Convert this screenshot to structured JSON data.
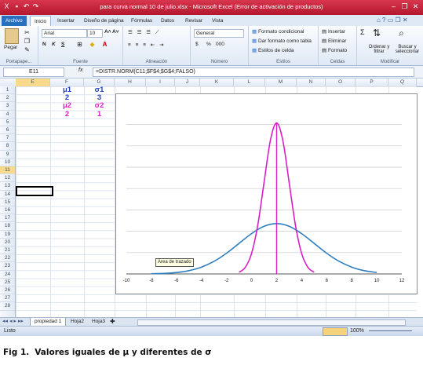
{
  "window": {
    "title": "para curva normal 10 de julio.xlsx  -  Microsoft Excel (Error de activación de productos)"
  },
  "ribbon": {
    "tabs": [
      "Archivo",
      "Inicio",
      "Insertar",
      "Diseño de página",
      "Fórmulas",
      "Datos",
      "Revisar",
      "Vista"
    ],
    "active_tab": "Inicio",
    "clipboard": {
      "paste": "Pegar",
      "label": "Portapape..."
    },
    "font": {
      "name": "Arial",
      "size": "10",
      "label": "Fuente",
      "bold": "N",
      "italic": "K",
      "underline": "S"
    },
    "alignment": {
      "label": "Alineación"
    },
    "number": {
      "format": "General",
      "label": "Número",
      "currency": "$",
      "percent": "%",
      "thousands": "000"
    },
    "styles": {
      "cond_format": "Formato condicional",
      "table_format": "Dar formato como tabla",
      "cell_styles": "Estilos de celda",
      "label": "Estilos"
    },
    "cells": {
      "insert": "Insertar",
      "delete": "Eliminar",
      "format": "Formato",
      "label": "Celdas"
    },
    "editing": {
      "sum": "Σ",
      "sort": "Ordenar y filtrar",
      "find": "Buscar y seleccionar",
      "label": "Modificar"
    }
  },
  "formula_bar": {
    "name_box": "E11",
    "fx": "fx",
    "formula": "=DISTR.NORM(C11;$F$4;$G$4;FALSO)"
  },
  "grid": {
    "columns": [
      "E",
      "F",
      "G",
      "H",
      "I",
      "J",
      "K",
      "L",
      "M",
      "N",
      "O",
      "P",
      "Q"
    ],
    "rows": [
      "1",
      "2",
      "3",
      "4",
      "5",
      "6",
      "7",
      "8",
      "9",
      "10",
      "11",
      "12",
      "13",
      "14",
      "15",
      "16",
      "17",
      "18",
      "19",
      "20",
      "21",
      "22",
      "23",
      "24",
      "25",
      "26",
      "27",
      "28"
    ],
    "selected_column": "E",
    "selected_row": "11",
    "cells": [
      {
        "ref": "F1",
        "text": "μ1",
        "color": "#1f3fbf"
      },
      {
        "ref": "G1",
        "text": "σ1",
        "color": "#1f3fbf"
      },
      {
        "ref": "F2",
        "text": "2",
        "color": "#1f3fbf"
      },
      {
        "ref": "G2",
        "text": "3",
        "color": "#1f3fbf"
      },
      {
        "ref": "F3",
        "text": "μ2",
        "color": "#e020c8"
      },
      {
        "ref": "G3",
        "text": "σ2",
        "color": "#e020c8"
      },
      {
        "ref": "F4",
        "text": "2",
        "color": "#e020c8"
      },
      {
        "ref": "G4",
        "text": "1",
        "color": "#e020c8"
      }
    ]
  },
  "chart_data": {
    "type": "line",
    "xlim": [
      -10,
      12
    ],
    "x_ticks": [
      "-10",
      "-8",
      "-6",
      "-4",
      "-2",
      "0",
      "2",
      "4",
      "6",
      "8",
      "10",
      "12"
    ],
    "grid": "horizontal",
    "legend": "none",
    "tooltip": "Área de trazado",
    "series": [
      {
        "mu": 2,
        "sigma": 3,
        "color": "#2f7fc0",
        "x": [
          -8,
          -7,
          -6,
          -5,
          -4,
          -3,
          -2,
          -1,
          0,
          1,
          2,
          3,
          4,
          5,
          6,
          7,
          8,
          9,
          10
        ],
        "y": [
          0.0006,
          0.0015,
          0.0038,
          0.0087,
          0.018,
          0.0332,
          0.0547,
          0.0807,
          0.1065,
          0.1258,
          0.133,
          0.1258,
          0.1065,
          0.0807,
          0.0547,
          0.0332,
          0.018,
          0.0087,
          0.0038
        ]
      },
      {
        "mu": 2,
        "sigma": 1,
        "color": "#d81ec8",
        "x": [
          -1,
          -0.5,
          0,
          0.5,
          1,
          1.5,
          2,
          2.5,
          3,
          3.5,
          4,
          4.5,
          5
        ],
        "y": [
          0.0044,
          0.0175,
          0.054,
          0.1295,
          0.242,
          0.3521,
          0.3989,
          0.3521,
          0.242,
          0.1295,
          0.054,
          0.0175,
          0.0044
        ]
      }
    ],
    "vertical_line_x": 2
  },
  "sheets": {
    "tabs": [
      "propiedad 1",
      "Hoja2",
      "Hoja3"
    ],
    "active": "propiedad 1"
  },
  "status": {
    "ready": "Listo",
    "zoom": "100%"
  },
  "caption": {
    "lead": "Fig 1.",
    "text": "Valores iguales de μ y diferentes de σ"
  }
}
